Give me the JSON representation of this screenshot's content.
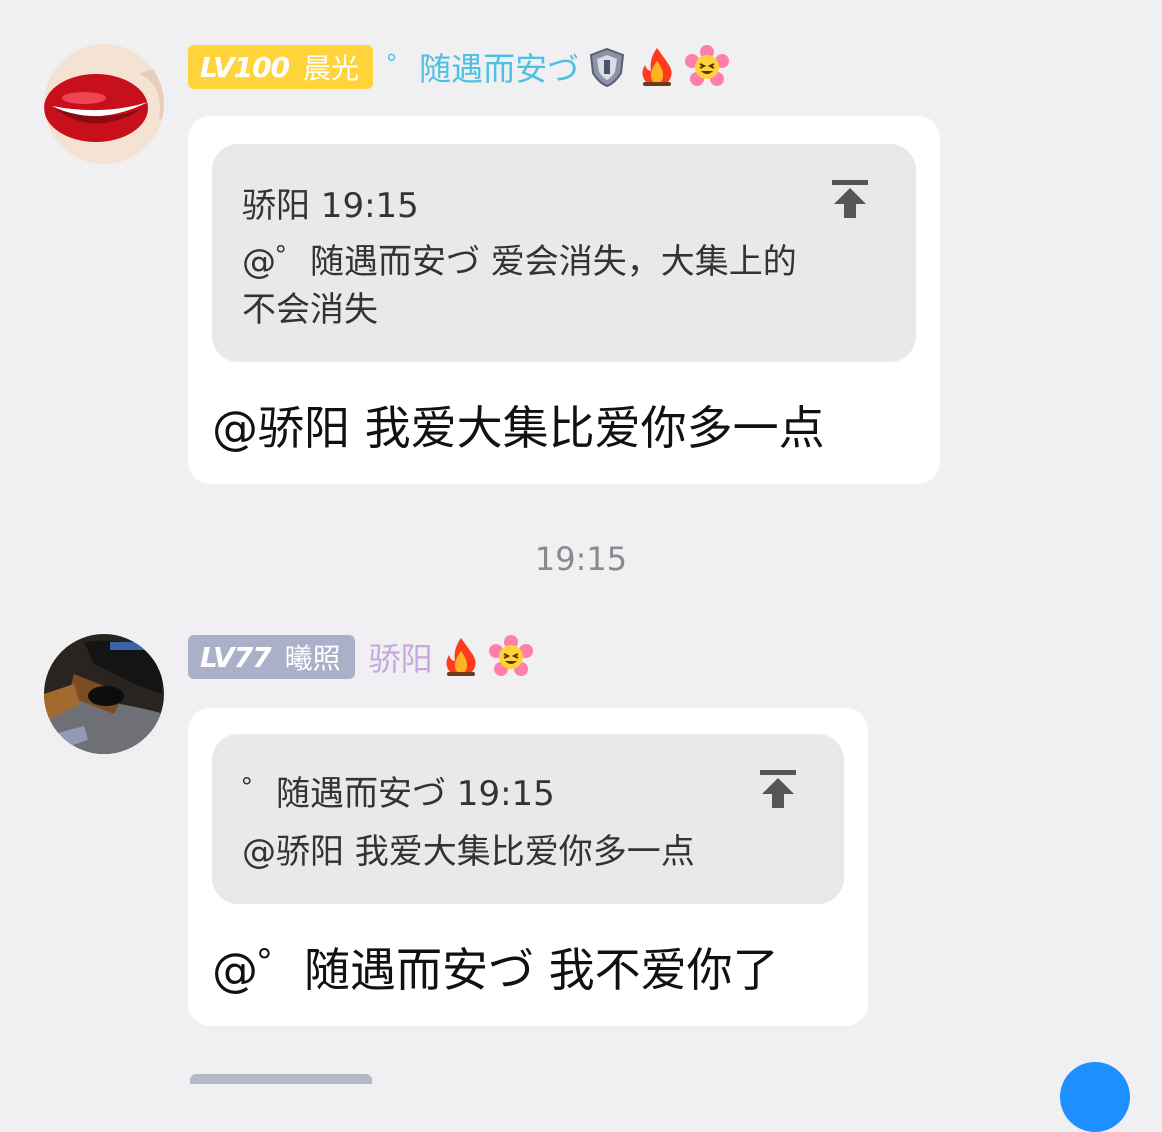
{
  "messages": [
    {
      "level": "LV100",
      "level_tag": "晨光",
      "level_color": "#ffd43b",
      "username": "゜随遇而安づ",
      "username_color": "#4ec0e0",
      "badges": [
        "shield-badge-icon",
        "fire-icon",
        "laughing-flower-icon"
      ],
      "avatar": "red-lips-avatar",
      "quote": {
        "author_time": "骄阳 19:15",
        "text_line1": "@゜随遇而安づ 爱会消失，大集上的",
        "text_line2": "不会消失"
      },
      "text": "@骄阳 我爱大集比爱你多一点"
    },
    {
      "level": "LV77",
      "level_tag": "曦照",
      "level_color": "#a9b0c8",
      "username": "骄阳",
      "username_color": "#c8a6e0",
      "badges": [
        "fire-icon",
        "laughing-flower-icon"
      ],
      "avatar": "night-photo-avatar",
      "quote": {
        "author_time": "゜随遇而安づ 19:15",
        "text_line1": "@骄阳 我爱大集比爱你多一点"
      },
      "text": "@゜随遇而安づ 我不爱你了"
    }
  ],
  "divider_time": "19:15"
}
